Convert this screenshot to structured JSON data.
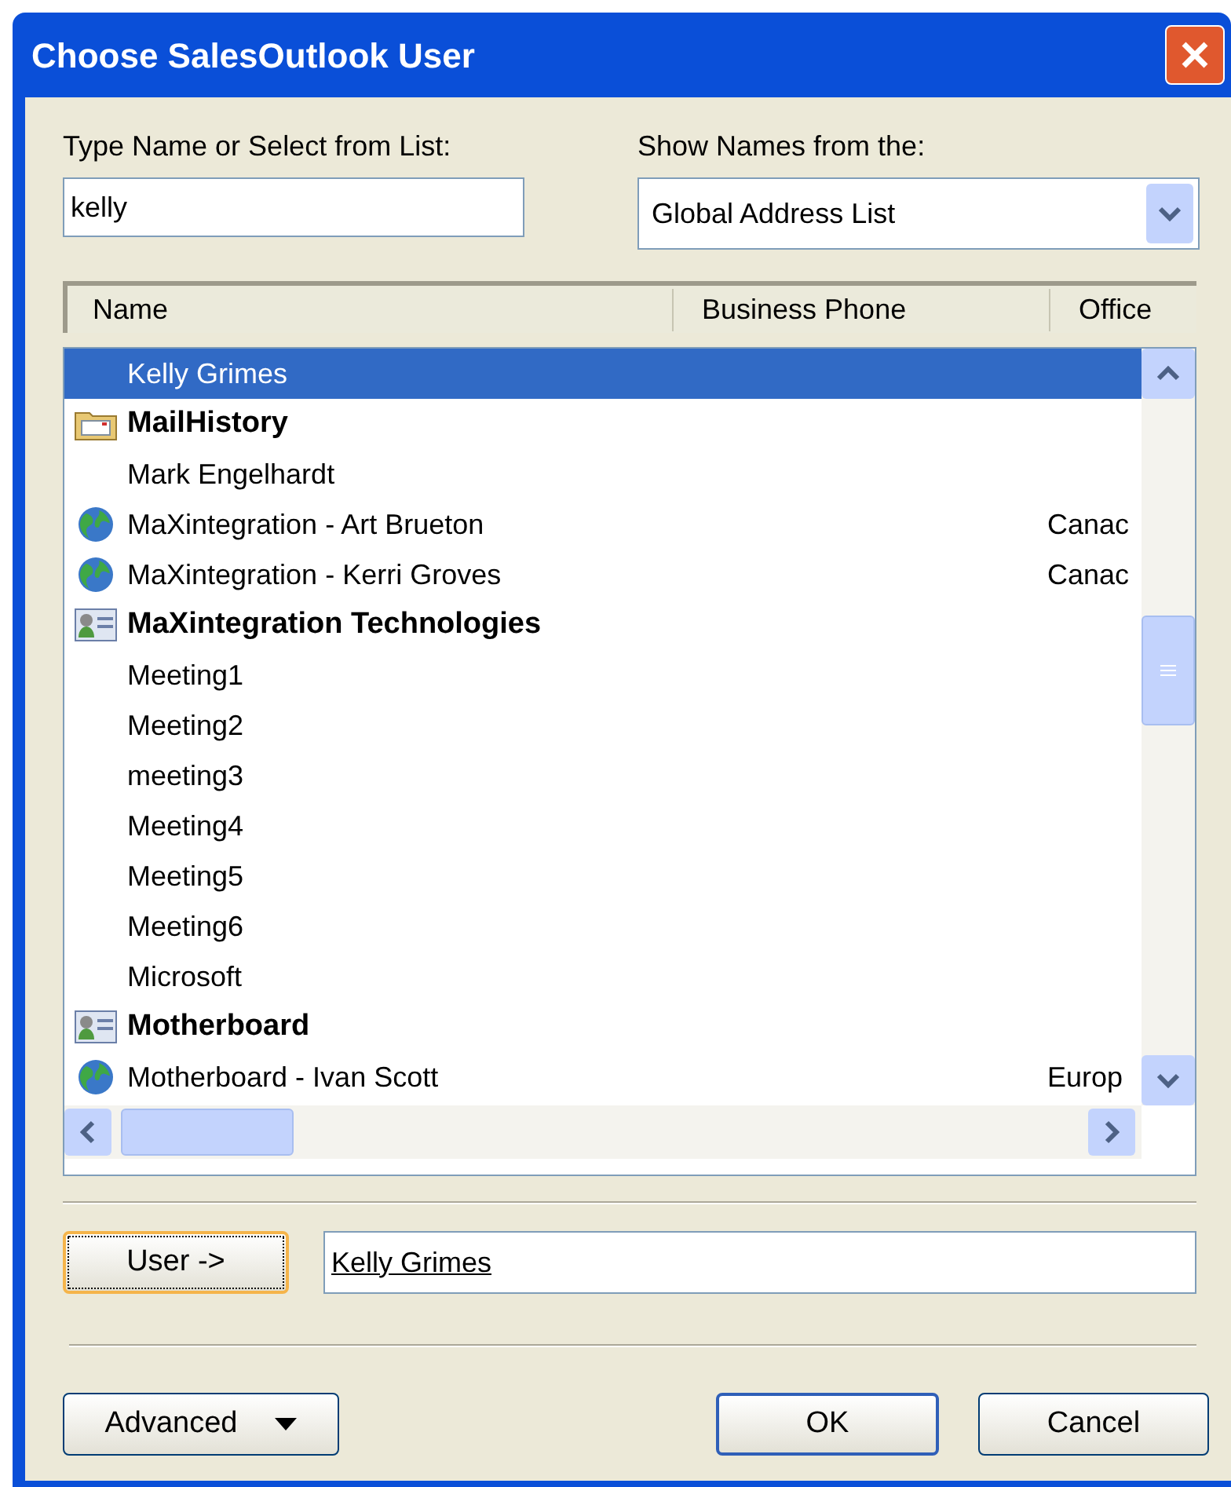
{
  "window": {
    "title": "Choose SalesOutlook User"
  },
  "name_field": {
    "label": "Type Name or Select from List:",
    "value": "kelly"
  },
  "source": {
    "label": "Show Names from the:",
    "value": "Global Address List"
  },
  "table": {
    "columns": [
      "Name",
      "Business Phone",
      "Office"
    ],
    "rows": [
      {
        "kind": "contact",
        "name": "Kelly Grimes",
        "office": "",
        "selected": true
      },
      {
        "kind": "folder",
        "name": "MailHistory",
        "office": "",
        "selected": false
      },
      {
        "kind": "contact",
        "name": "Mark Engelhardt",
        "office": "",
        "selected": false
      },
      {
        "kind": "globe",
        "name": "MaXintegration - Art Brueton",
        "office": "Canac",
        "selected": false
      },
      {
        "kind": "globe",
        "name": "MaXintegration - Kerri Groves",
        "office": "Canac",
        "selected": false
      },
      {
        "kind": "group",
        "name": "MaXintegration Technologies",
        "office": "",
        "selected": false
      },
      {
        "kind": "contact",
        "name": "Meeting1",
        "office": "",
        "selected": false
      },
      {
        "kind": "contact",
        "name": "Meeting2",
        "office": "",
        "selected": false
      },
      {
        "kind": "contact",
        "name": "meeting3",
        "office": "",
        "selected": false
      },
      {
        "kind": "contact",
        "name": "Meeting4",
        "office": "",
        "selected": false
      },
      {
        "kind": "contact",
        "name": "Meeting5",
        "office": "",
        "selected": false
      },
      {
        "kind": "contact",
        "name": "Meeting6",
        "office": "",
        "selected": false
      },
      {
        "kind": "contact",
        "name": "Microsoft",
        "office": "",
        "selected": false
      },
      {
        "kind": "group",
        "name": "Motherboard",
        "office": "",
        "selected": false
      },
      {
        "kind": "globe",
        "name": "Motherboard - Ivan Scott",
        "office": "Europ",
        "selected": false
      }
    ]
  },
  "user_button": {
    "label": "User ->"
  },
  "user_field": {
    "value": "Kelly Grimes"
  },
  "buttons": [
    {
      "kind": "menu",
      "label": "Advanced"
    },
    {
      "kind": "default",
      "label": "OK"
    },
    {
      "kind": "plain",
      "label": "Cancel"
    }
  ]
}
